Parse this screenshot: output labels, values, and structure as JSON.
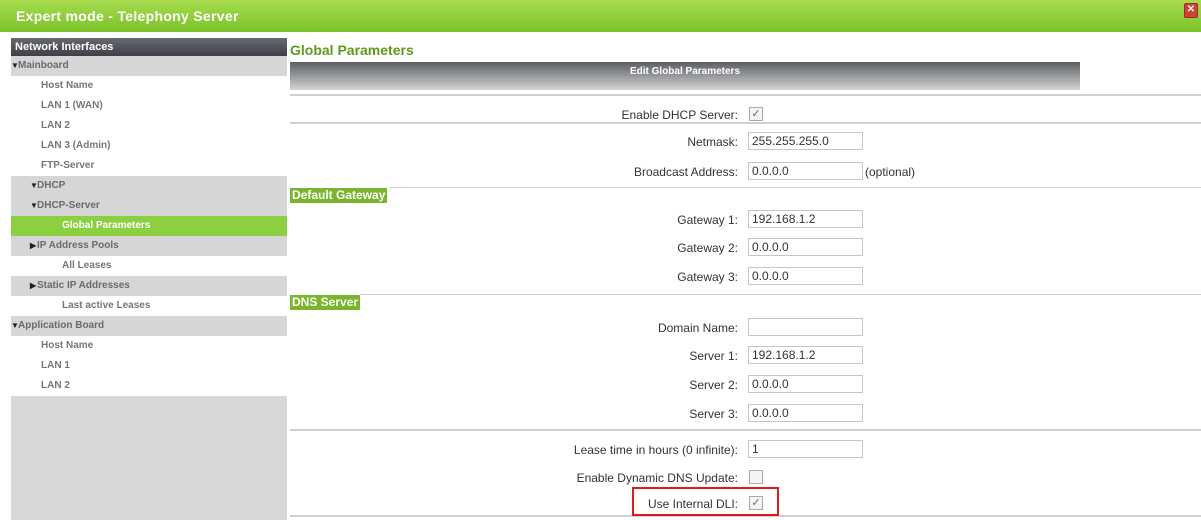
{
  "window": {
    "title": "Expert mode - Telephony Server",
    "close_glyph": "✕"
  },
  "sidebar": {
    "header": "Network Interfaces",
    "items": [
      {
        "label": "Mainboard",
        "arrow": "▼",
        "indent": 0,
        "kind": "group"
      },
      {
        "label": "Host Name",
        "arrow": "",
        "indent": 1,
        "kind": "item"
      },
      {
        "label": "LAN 1 (WAN)",
        "arrow": "",
        "indent": 1,
        "kind": "item"
      },
      {
        "label": "LAN 2",
        "arrow": "",
        "indent": 1,
        "kind": "item"
      },
      {
        "label": "LAN 3 (Admin)",
        "arrow": "",
        "indent": 1,
        "kind": "item"
      },
      {
        "label": "FTP-Server",
        "arrow": "",
        "indent": 1,
        "kind": "item"
      },
      {
        "label": "DHCP",
        "arrow": "▼",
        "indent": 1,
        "kind": "group"
      },
      {
        "label": "DHCP-Server",
        "arrow": "▼",
        "indent": 2,
        "kind": "group"
      },
      {
        "label": "Global Parameters",
        "arrow": "",
        "indent": 3,
        "kind": "selected"
      },
      {
        "label": "IP Address Pools",
        "arrow": "▶",
        "indent": 2,
        "kind": "group"
      },
      {
        "label": "All Leases",
        "arrow": "",
        "indent": 3,
        "kind": "item"
      },
      {
        "label": "Static IP Addresses",
        "arrow": "▶",
        "indent": 2,
        "kind": "group"
      },
      {
        "label": "Last active Leases",
        "arrow": "",
        "indent": 3,
        "kind": "item"
      },
      {
        "label": "Application Board",
        "arrow": "▼",
        "indent": 0,
        "kind": "group"
      },
      {
        "label": "Host Name",
        "arrow": "",
        "indent": 1,
        "kind": "item"
      },
      {
        "label": "LAN 1",
        "arrow": "",
        "indent": 1,
        "kind": "item"
      },
      {
        "label": "LAN 2",
        "arrow": "",
        "indent": 1,
        "kind": "item"
      }
    ]
  },
  "main": {
    "title": "Global Parameters",
    "edit_header": "Edit Global Parameters",
    "enable_dhcp": {
      "label": "Enable DHCP Server:",
      "checked": true
    },
    "netmask": {
      "label": "Netmask:",
      "value": "255.255.255.0"
    },
    "broadcast": {
      "label": "Broadcast Address:",
      "value": "0.0.0.0",
      "note": "(optional)"
    },
    "gateway_section": "Default Gateway",
    "gateway1": {
      "label": "Gateway 1:",
      "value": "192.168.1.2"
    },
    "gateway2": {
      "label": "Gateway 2:",
      "value": "0.0.0.0"
    },
    "gateway3": {
      "label": "Gateway 3:",
      "value": "0.0.0.0"
    },
    "dns_section": "DNS Server",
    "domain": {
      "label": "Domain Name:",
      "value": ""
    },
    "server1": {
      "label": "Server 1:",
      "value": "192.168.1.2"
    },
    "server2": {
      "label": "Server 2:",
      "value": "0.0.0.0"
    },
    "server3": {
      "label": "Server 3:",
      "value": "0.0.0.0"
    },
    "lease": {
      "label": "Lease time in hours (0 infinite):",
      "value": "1"
    },
    "dyn_dns": {
      "label": "Enable Dynamic DNS Update:",
      "checked": false
    },
    "internal_dli": {
      "label": "Use Internal DLI:",
      "checked": true
    },
    "check_glyph": "✓"
  },
  "colors": {
    "brand": "#7bc22a",
    "selected": "#8cd042",
    "section": "#79b62c",
    "highlight": "#e11a1a"
  }
}
